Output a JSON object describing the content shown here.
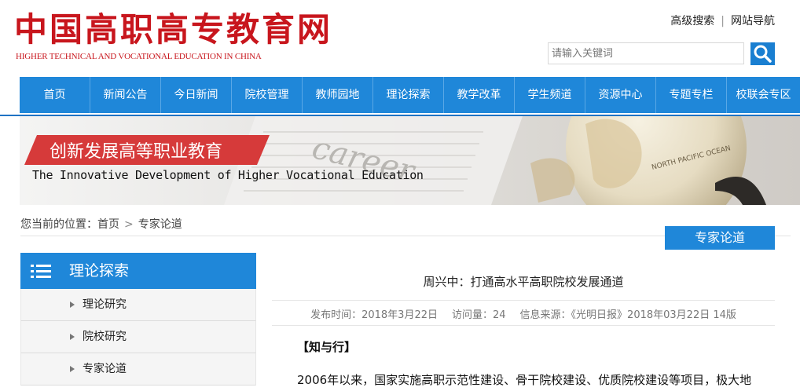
{
  "header": {
    "logo_cn": "中国高职高专教育网",
    "logo_en": "HIGHER TECHNICAL AND VOCATIONAL EDUCATION IN CHINA",
    "links": [
      "高级搜索",
      "网站导航"
    ],
    "search_placeholder": "请输入关键词",
    "search_icon": "search-icon"
  },
  "nav": [
    "首页",
    "新闻公告",
    "今日新闻",
    "院校管理",
    "教师园地",
    "理论探索",
    "教学改革",
    "学生频道",
    "资源中心",
    "专题专栏",
    "校联会专区"
  ],
  "banner": {
    "title": "创新发展高等职业教育",
    "subtitle": "The Innovative Development of Higher Vocational Education",
    "globe_text": "NORTH PACIFIC OCEAN",
    "paper_text": "career"
  },
  "breadcrumb": {
    "prefix": "您当前的位置：",
    "items": [
      "首页",
      "专家论道"
    ]
  },
  "section_tab": "专家论道",
  "sidebar": {
    "title": "理论探索",
    "items": [
      "理论研究",
      "院校研究",
      "专家论道"
    ]
  },
  "article": {
    "title": "周兴中：打通高水平高职院校发展通道",
    "meta": {
      "date": "发布时间：2018年3月22日",
      "views": "访问量：24",
      "source": "信息来源：《光明日报》2018年03月22日 14版"
    },
    "subhead": "【知与行】",
    "paragraph": "2006年以来，国家实施高职示范性建设、骨干院校建设、优质院校建设等项目，极大地"
  },
  "colors": {
    "brand_red": "#c8161d",
    "nav_blue": "#1f87d9",
    "accent": "#d63a3a"
  }
}
